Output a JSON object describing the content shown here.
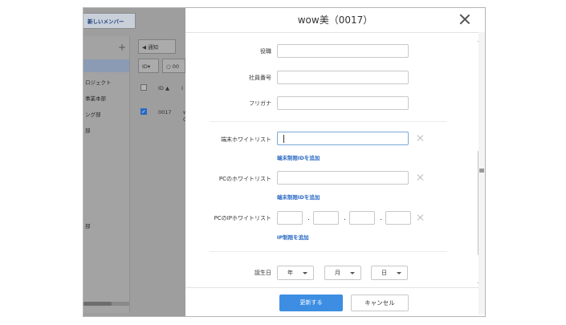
{
  "background": {
    "new_member_button": "新しいメンバー",
    "add_icon": "+",
    "side_items": [
      "ロジェクト",
      "事業本部",
      "ング部",
      "部",
      "部"
    ],
    "toolbar_notify": "通知",
    "toolbar_id": "ID▾",
    "toolbar_search_value": "00",
    "table_header_id": "ID ▲",
    "table_header_extra": "I",
    "row_id": "0017",
    "row_extra": "w",
    "row_extra2": "C"
  },
  "modal": {
    "title": "wow美（0017）",
    "fields": {
      "title_label": "役職",
      "employee_no_label": "社員番号",
      "furigana_label": "フリガナ",
      "device_whitelist_label": "端末ホワイトリスト",
      "device_whitelist_link": "端末制限IDを追加",
      "pc_whitelist_label": "PCのホワイトリスト",
      "pc_whitelist_link": "端末制限IDを追加",
      "pc_ip_whitelist_label": "PCのIPホワイトリスト",
      "ip_separator": ".",
      "ip_link": "IP制限を追加",
      "birthday_label": "誕生日",
      "year_select": "年",
      "month_select": "月",
      "day_select": "日"
    },
    "footer": {
      "update_button": "更新する",
      "cancel_button": "キャンセル"
    }
  },
  "colors": {
    "primary": "#3d8ee3",
    "link": "#2a69c4",
    "overlay": "#9e9e9e"
  },
  "icons": [
    "close-icon",
    "clear-icon",
    "chevron-down-icon",
    "megaphone-icon",
    "search-icon",
    "checkbox-icon"
  ]
}
